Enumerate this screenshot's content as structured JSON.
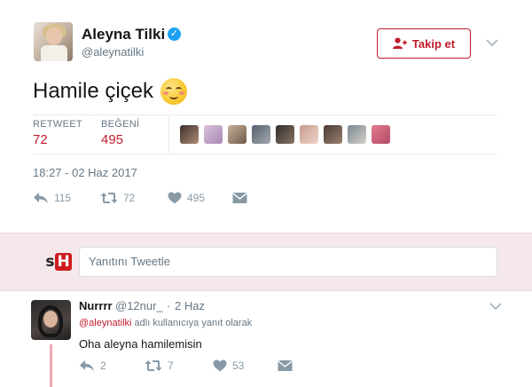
{
  "tweet": {
    "author_name": "Aleyna Tilki",
    "author_handle": "@aleynatilki",
    "follow_label": "Takip et",
    "text": "Hamile çiçek",
    "stats": {
      "retweet_label": "RETWEET",
      "retweet_count": "72",
      "like_label": "BEĞENİ",
      "like_count": "495"
    },
    "timestamp": "18:27 - 02 Haz 2017",
    "actions": {
      "reply_count": "115",
      "retweet_count": "72",
      "like_count": "495"
    }
  },
  "reply_box": {
    "logo_text_s": "s",
    "logo_text_h": "H",
    "placeholder": "Yanıtını Tweetle"
  },
  "reply_tweet": {
    "author_name": "Nurrrr",
    "author_handle": "@12nur_",
    "dot": "·",
    "date": "2 Haz",
    "context_mention": "@aleynatilki",
    "context_suffix": " adlı kullanıcıya yanıt olarak",
    "text": "Oha aleyna hamilemisin",
    "actions": {
      "reply_count": "2",
      "retweet_count": "7",
      "like_count": "53"
    }
  },
  "colors": {
    "accent": "#c01c2c",
    "muted": "#657786",
    "icon": "#8899a6",
    "verified": "#1da1f2",
    "reply_bar_bg": "#f5e8ea"
  }
}
